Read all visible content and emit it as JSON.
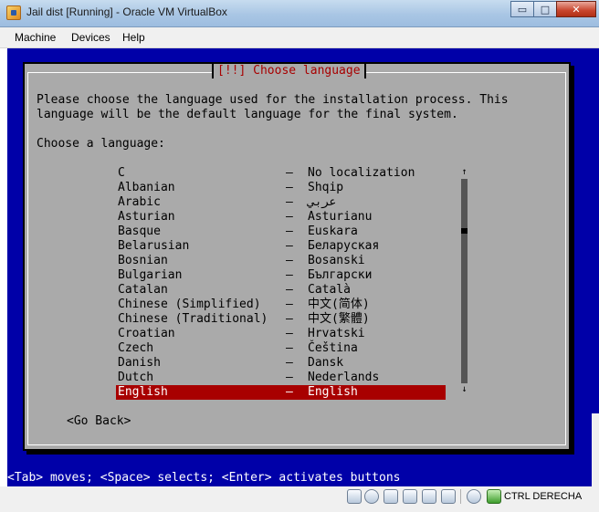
{
  "window": {
    "title": "Jail dist [Running] - Oracle VM VirtualBox",
    "minimize_glyph": "▭",
    "maximize_glyph": "□",
    "close_glyph": "✕"
  },
  "menu": {
    "items": [
      "Machine",
      "Devices",
      "Help"
    ]
  },
  "installer": {
    "dialog_title": "[!!] Choose language",
    "description_lines": [
      "Please choose the language used for the installation process. This",
      "language will be the default language for the final system."
    ],
    "prompt": "Choose a language:",
    "languages": [
      {
        "name": "C",
        "native": "No localization"
      },
      {
        "name": "Albanian",
        "native": "Shqip"
      },
      {
        "name": "Arabic",
        "native": "عربي"
      },
      {
        "name": "Asturian",
        "native": "Asturianu"
      },
      {
        "name": "Basque",
        "native": "Euskara"
      },
      {
        "name": "Belarusian",
        "native": "Беларуская"
      },
      {
        "name": "Bosnian",
        "native": "Bosanski"
      },
      {
        "name": "Bulgarian",
        "native": "Български"
      },
      {
        "name": "Catalan",
        "native": "Català"
      },
      {
        "name": "Chinese (Simplified)",
        "native": "中文(简体)"
      },
      {
        "name": "Chinese (Traditional)",
        "native": "中文(繁體)"
      },
      {
        "name": "Croatian",
        "native": "Hrvatski"
      },
      {
        "name": "Czech",
        "native": "Čeština"
      },
      {
        "name": "Danish",
        "native": "Dansk"
      },
      {
        "name": "Dutch",
        "native": "Nederlands"
      },
      {
        "name": "English",
        "native": "English"
      }
    ],
    "separator": "–",
    "selected_language": "English",
    "scroll_up_glyph": "↑",
    "scroll_down_glyph": "↓",
    "go_back_label": "<Go Back>",
    "status_line": "<Tab> moves; <Space> selects; <Enter> activates buttons"
  },
  "statusbar": {
    "icons": [
      "hard-disk-icon",
      "optical-disc-icon",
      "usb-icon",
      "shared-folders-icon",
      "network-icon",
      "display-icon",
      "mouse-integration-icon",
      "host-key-icon"
    ],
    "host_key_label": "CTRL DERECHA"
  },
  "colors": {
    "vm_background": "#0000a8",
    "dialog_background": "#aaaaaa",
    "title_red": "#a80000",
    "selection_background": "#a80000",
    "selection_text": "#ffffff"
  }
}
